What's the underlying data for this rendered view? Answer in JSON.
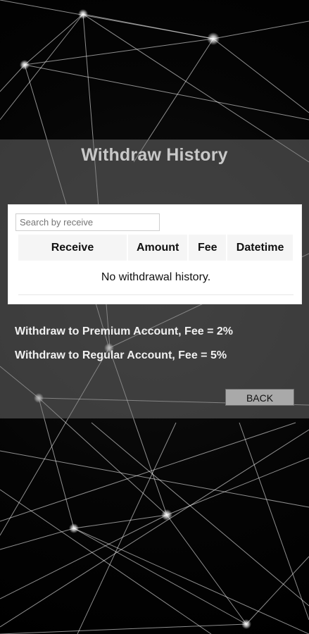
{
  "page": {
    "title": "Withdraw History"
  },
  "search": {
    "placeholder": "Search by receive"
  },
  "table": {
    "columns": [
      "Receive",
      "Amount",
      "Fee",
      "Datetime"
    ],
    "empty_message": "No withdrawal history."
  },
  "info": {
    "premium_fee": "Withdraw to Premium Account, Fee = 2%",
    "regular_fee": "Withdraw to Regular Account, Fee = 5%"
  },
  "buttons": {
    "back": "BACK"
  },
  "colors": {
    "background": "#000000",
    "overlay": "#777777",
    "card": "#ffffff",
    "button": "#a9a9a9"
  }
}
